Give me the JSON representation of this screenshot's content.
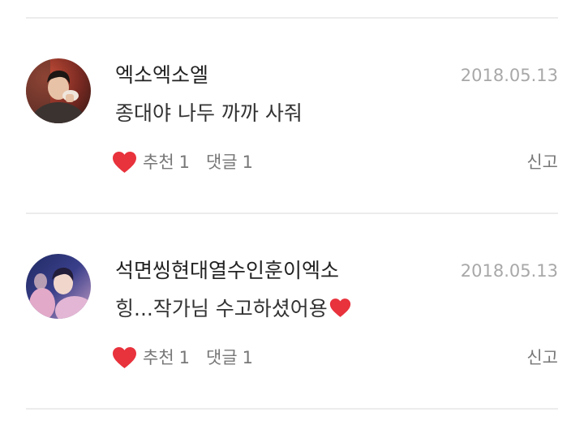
{
  "comments": [
    {
      "username": "엑소엑소엘",
      "date": "2018.05.13",
      "text": "종대야 나두 까까 사줘",
      "text_emoji": "",
      "like_label": "추천",
      "like_count": "1",
      "reply_label": "댓글",
      "reply_count": "1",
      "report_label": "신고"
    },
    {
      "username": "석면씽현대열수인훈이엑소",
      "date": "2018.05.13",
      "text": "힝...작가님 수고하셨어용",
      "text_emoji": "heart-emoji",
      "like_label": "추천",
      "like_count": "1",
      "reply_label": "댓글",
      "reply_count": "1",
      "report_label": "신고"
    }
  ],
  "colors": {
    "heart": "#e8323c",
    "divider": "#ececec",
    "meta": "#a8a8a8",
    "action": "#777777"
  },
  "icons": {
    "like": "heart-icon",
    "avatar": "user-avatar"
  }
}
